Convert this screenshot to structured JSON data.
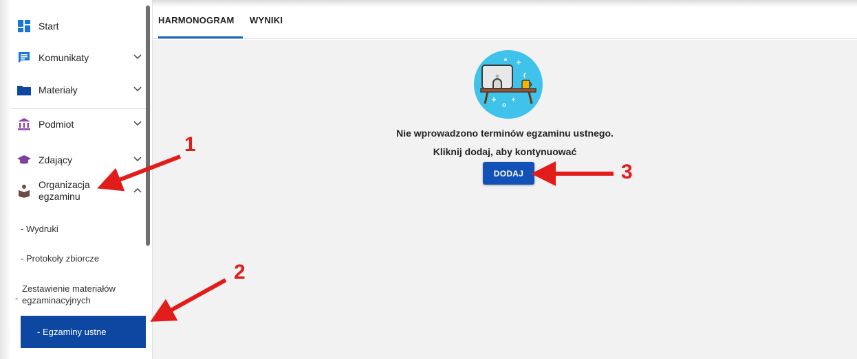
{
  "sidebar": {
    "items": [
      {
        "label": "Start",
        "icon": "dashboard-icon"
      },
      {
        "label": "Komunikaty",
        "icon": "message-icon"
      },
      {
        "label": "Materiały",
        "icon": "folder-icon"
      },
      {
        "label": "Podmiot",
        "icon": "institution-icon"
      },
      {
        "label": "Zdający",
        "icon": "graduation-cap-icon"
      },
      {
        "label_line1": "Organizacja",
        "label_line2": "egzaminu",
        "icon": "desk-reader-icon"
      }
    ],
    "subitems": [
      {
        "label": "- Wydruki"
      },
      {
        "label": "- Protokoły zbiorcze"
      },
      {
        "label_line1": "Zestawienie materiałów",
        "label_line2": "egzaminacyjnych",
        "prefix": "-"
      },
      {
        "label": "- Egzaminy ustne"
      }
    ]
  },
  "tabs": [
    {
      "label": "HARMONOGRAM",
      "active": true
    },
    {
      "label": "WYNIKI",
      "active": false
    }
  ],
  "main": {
    "empty_title": "Nie wprowadzono terminów egzaminu ustnego.",
    "empty_subtitle": "Kliknij dodaj, aby kontynuować",
    "add_button": "DODAJ"
  },
  "annotations": [
    "1",
    "2",
    "3"
  ],
  "colors": {
    "accent": "#1565c0",
    "active_item": "#0d47a1",
    "button": "#1252b8",
    "annotation": "#e21b1b"
  }
}
